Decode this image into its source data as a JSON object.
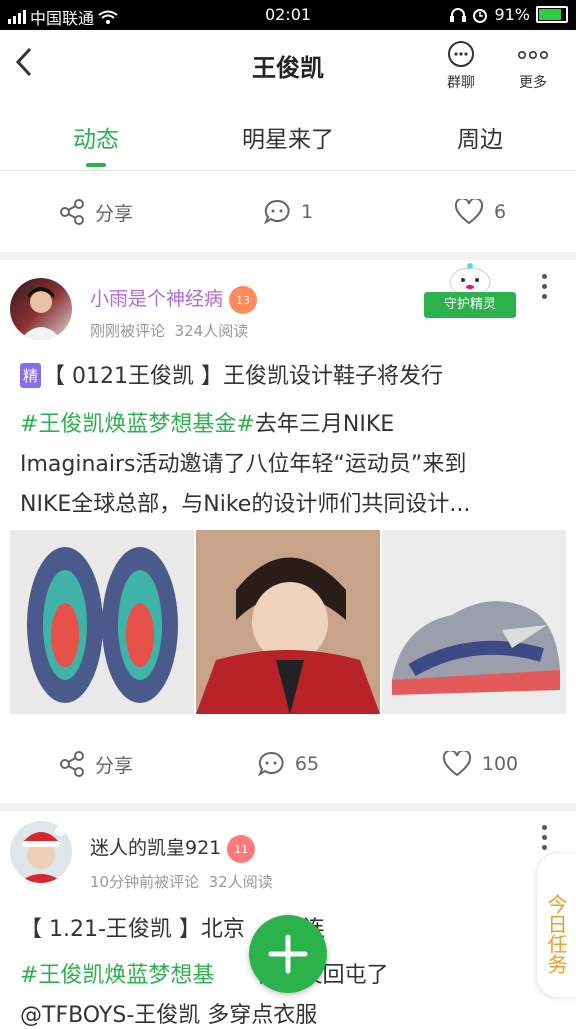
{
  "status_bar": {
    "carrier": "中国联通",
    "time": "02:01",
    "battery": "91%"
  },
  "header": {
    "title": "王俊凯",
    "group_chat_label": "群聊",
    "more_label": "更多"
  },
  "tabs": [
    {
      "label": "动态",
      "active": true
    },
    {
      "label": "明星来了",
      "active": false
    },
    {
      "label": "周边",
      "active": false
    }
  ],
  "top_actions": {
    "share_label": "分享",
    "comment_count": "1",
    "like_count": "6"
  },
  "posts": [
    {
      "username": "小雨是个神经病",
      "level": "13",
      "badge": "守护精灵",
      "time_text": "刚刚被评论",
      "reads": "324人阅读",
      "tag": "精",
      "title": "【 0121王俊凯 】王俊凯设计鞋子将发行",
      "hashtag": "#王俊凯焕蓝梦想基金#",
      "line1_rest": "去年三月NIKE",
      "line2": "Imaginairs活动邀请了八位年轻“运动员”来到",
      "line3": "NIKE全球总部，与Nike的设计师们共同设计...",
      "share_label": "分享",
      "comment_count": "65",
      "like_count": "100"
    },
    {
      "username": "迷人的凯皇921",
      "level": "11",
      "time_text": "10分钟前被评论",
      "reads": "32人阅读",
      "title": "【 1.21-王俊凯 】北京",
      "title_rest": "连",
      "hashtag": "#王俊凯焕蓝梦想基",
      "line1_rest": "保庆又回屯了",
      "line2": "@TFBOYS-王俊凯 多穿点衣服"
    }
  ],
  "task_label": "今日任务",
  "colors": {
    "accent": "#2bb24c",
    "task": "#f59a23",
    "tag": "#8a6cf0"
  }
}
